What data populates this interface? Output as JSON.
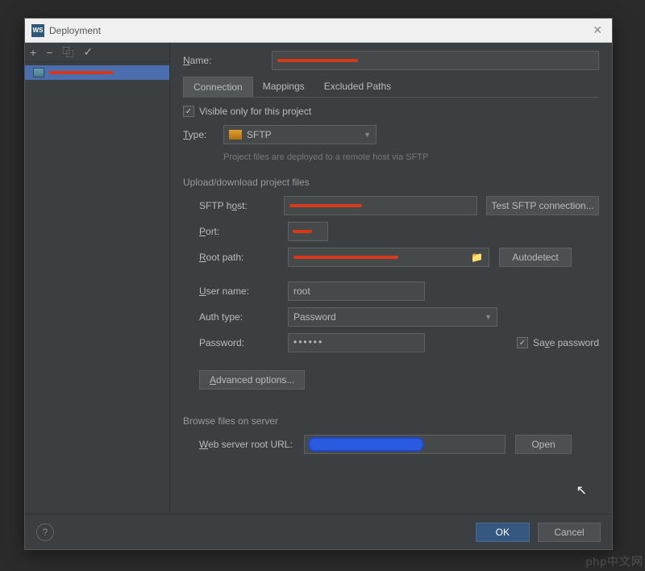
{
  "titlebar": {
    "title": "Deployment",
    "icon_label": "WS"
  },
  "sidebar": {
    "toolbar": {
      "add": "+",
      "remove": "−",
      "copy": "⿻",
      "check": "✓"
    },
    "items": [
      {
        "label_redacted": true
      }
    ]
  },
  "form": {
    "name_label": "Name:",
    "tabs": {
      "connection": "Connection",
      "mappings": "Mappings",
      "excluded": "Excluded Paths"
    },
    "visible_label": "Visible only for this project",
    "visible_checked": true,
    "type_label": "Type:",
    "type_value": "SFTP",
    "type_hint": "Project files are deployed to a remote host via SFTP",
    "section_upload": "Upload/download project files",
    "host_label": "SFTP host:",
    "test_btn": "Test SFTP connection...",
    "port_label": "Port:",
    "root_label": "Root path:",
    "autodetect_btn": "Autodetect",
    "user_label": "User name:",
    "user_value": "root",
    "auth_label": "Auth type:",
    "auth_value": "Password",
    "pwd_label": "Password:",
    "pwd_value": "••••••",
    "save_pwd_label": "Save password",
    "save_pwd_checked": true,
    "advanced_btn": "Advanced options...",
    "section_browse": "Browse files on server",
    "url_label": "Web server root URL:",
    "open_btn": "Open"
  },
  "footer": {
    "ok": "OK",
    "cancel": "Cancel",
    "help": "?"
  },
  "watermark": "php中文网"
}
